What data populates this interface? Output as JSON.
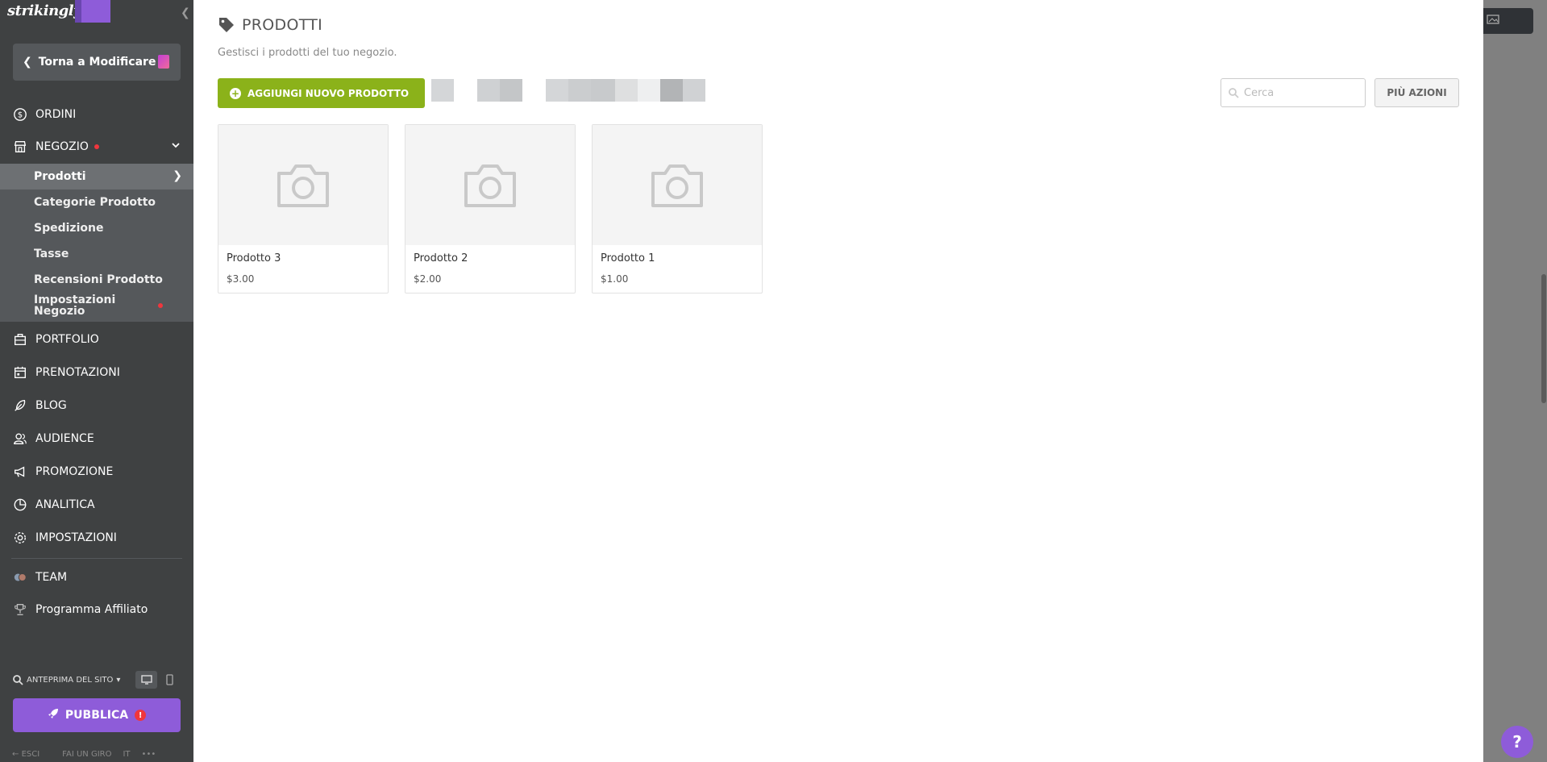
{
  "brand": {
    "logo_text": "strikingly",
    "accent": "#8e5cd9",
    "green": "#8bb21a"
  },
  "sidebar": {
    "back_label": "Torna a Modificare",
    "nav": [
      {
        "label": "Ordini",
        "icon": "dollar-circle-icon"
      },
      {
        "label": "Negozio",
        "icon": "store-icon"
      },
      {
        "label": "Portfolio",
        "icon": "briefcase-icon"
      },
      {
        "label": "Prenotazioni",
        "icon": "calendar-icon"
      },
      {
        "label": "Blog",
        "icon": "feather-icon"
      },
      {
        "label": "Audience",
        "icon": "users-icon"
      },
      {
        "label": "Promozione",
        "icon": "megaphone-icon"
      },
      {
        "label": "Analitica",
        "icon": "pie-chart-icon"
      },
      {
        "label": "Impostazioni",
        "icon": "gear-icon"
      },
      {
        "label": "Team",
        "icon": "team-icon"
      },
      {
        "label": "Programma Affiliato",
        "icon": "trophy-icon"
      }
    ],
    "shop_sub": [
      {
        "label": "Prodotti"
      },
      {
        "label": "Categorie Prodotto"
      },
      {
        "label": "Spedizione"
      },
      {
        "label": "Tasse"
      },
      {
        "label": "Recensioni Prodotto"
      },
      {
        "label": "Impostazioni Negozio"
      }
    ],
    "preview_label": "ANTEPRIMA DEL SITO",
    "publish_label": "PUBBLICA",
    "footer": {
      "exit": "ESCI",
      "tour": "FAI UN GIRO",
      "lang": "IT",
      "more": "•••"
    }
  },
  "main": {
    "title": "PRODOTTI",
    "subtitle": "Gestisci i prodotti del tuo negozio.",
    "add_button": "AGGIUNGI NUOVO PRODOTTO",
    "search_placeholder": "Cerca",
    "more_actions": "PIÙ AZIONI",
    "products": [
      {
        "name": "Prodotto 3",
        "price": "$3.00"
      },
      {
        "name": "Prodotto 2",
        "price": "$2.00"
      },
      {
        "name": "Prodotto 1",
        "price": "$1.00"
      }
    ]
  },
  "help_label": "?"
}
